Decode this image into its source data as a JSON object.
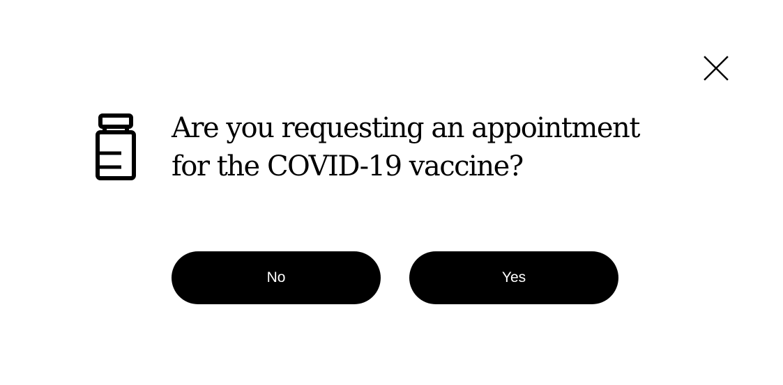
{
  "dialog": {
    "question_line_1": "Are you requesting an appointment",
    "question_line_2": "for the COVID-19 vaccine?",
    "vial_icon": "vaccine-vial-icon",
    "close_icon": "close-icon"
  },
  "actions": {
    "no_label": "No",
    "yes_label": "Yes"
  },
  "colors": {
    "background": "#ffffff",
    "text": "#000000",
    "button_bg": "#000000",
    "button_text": "#ffffff"
  }
}
